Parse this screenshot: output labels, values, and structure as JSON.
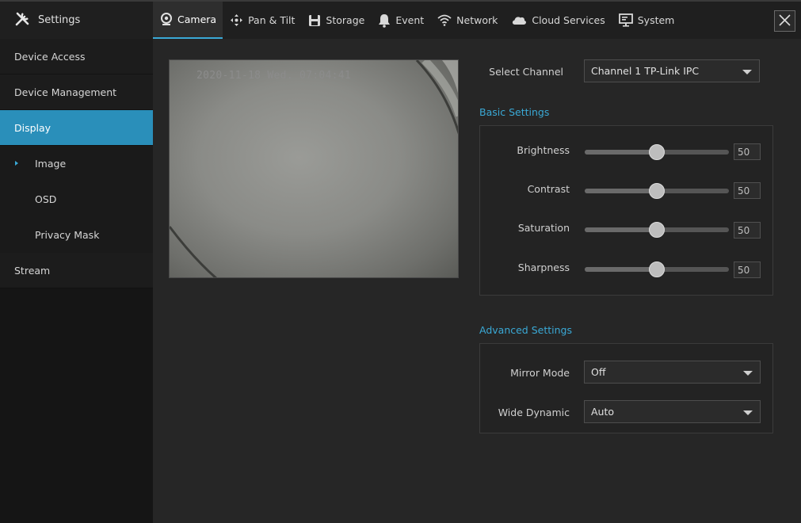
{
  "header": {
    "title": "Settings",
    "tabs": [
      {
        "label": "Camera",
        "icon": "camera-icon"
      },
      {
        "label": "Pan & Tilt",
        "icon": "pan-tilt-icon"
      },
      {
        "label": "Storage",
        "icon": "storage-icon"
      },
      {
        "label": "Event",
        "icon": "bell-icon"
      },
      {
        "label": "Network",
        "icon": "wifi-icon"
      },
      {
        "label": "Cloud Services",
        "icon": "cloud-icon"
      },
      {
        "label": "System",
        "icon": "monitor-icon"
      }
    ],
    "active_tab": "Camera"
  },
  "sidebar": {
    "items": [
      {
        "label": "Device Access"
      },
      {
        "label": "Device Management"
      },
      {
        "label": "Display"
      },
      {
        "label": "Image"
      },
      {
        "label": "OSD"
      },
      {
        "label": "Privacy Mask"
      },
      {
        "label": "Stream"
      }
    ],
    "active": "Display",
    "active_sub": "Image"
  },
  "preview": {
    "timestamp": "2020-11-18 Wed. 07:04:41"
  },
  "channel": {
    "label": "Select Channel",
    "value": "Channel 1 TP-Link IPC"
  },
  "basic": {
    "title": "Basic Settings",
    "sliders": [
      {
        "label": "Brightness",
        "value": "50",
        "level": 0.5
      },
      {
        "label": "Contrast",
        "value": "50",
        "level": 0.5
      },
      {
        "label": "Saturation",
        "value": "50",
        "level": 0.5
      },
      {
        "label": "Sharpness",
        "value": "50",
        "level": 0.5
      }
    ]
  },
  "advanced": {
    "title": "Advanced Settings",
    "mirror_label": "Mirror Mode",
    "mirror_value": "Off",
    "wdr_label": "Wide Dynamic",
    "wdr_value": "Auto"
  },
  "colors": {
    "accent": "#3aa9d6",
    "sidebar_active": "#2a8fba",
    "background": "#262626"
  }
}
